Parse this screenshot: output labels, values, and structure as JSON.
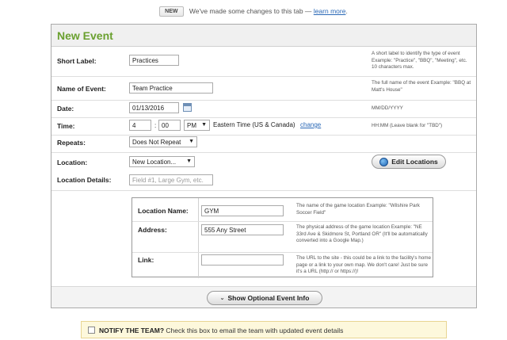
{
  "notice": {
    "badge": "NEW",
    "text": "We've made some changes to this tab —",
    "link": "learn more",
    "end": "."
  },
  "panel": {
    "title": "New Event"
  },
  "short_label": {
    "label": "Short Label:",
    "value": "Practices",
    "help": "A short label to identify the type of event Example: \"Practice\", \"BBQ\", \"Meeting\", etc. 10 characters max."
  },
  "name_of_event": {
    "label": "Name of Event:",
    "value": "Team Practice",
    "help": "The full name of the event Example: \"BBQ at Matt's House\""
  },
  "date": {
    "label": "Date:",
    "value": "01/13/2016",
    "help": "MM/DD/YYYY"
  },
  "time": {
    "label": "Time:",
    "hour": "4",
    "separator": ":",
    "minute": "00",
    "ampm": "PM",
    "timezone": "Eastern Time (US & Canada)",
    "change_link": "change",
    "help": "HH:MM (Leave blank for \"TBD\")"
  },
  "repeats": {
    "label": "Repeats:",
    "selected": "Does Not Repeat"
  },
  "location": {
    "label": "Location:",
    "selected": "New Location...",
    "edit_button": "Edit Locations"
  },
  "location_details": {
    "label": "Location Details:",
    "placeholder": "Field #1, Large Gym, etc."
  },
  "location_box": {
    "name": {
      "label": "Location Name:",
      "value": "GYM",
      "help": "The name of the game location Example: \"Wilshire Park Soccer Field\""
    },
    "address": {
      "label": "Address:",
      "value": "555 Any Street",
      "help": "The physical address of the game location Example: \"NE 33rd Ave & Skidmore St, Portland OR\" (It'll be automatically converted into a Google Map.)"
    },
    "link": {
      "label": "Link:",
      "value": "",
      "help": "The URL to the site - this could be a link to the facility's home page or a link to your own map. We don't care! Just be sure it's a URL (http:// or https://)!"
    }
  },
  "optional_button": "Show Optional Event Info",
  "notify": {
    "bold": "NOTIFY THE TEAM?",
    "text": "Check this box to email the team with updated event details",
    "checked": false
  },
  "colors": {
    "title_green": "#6aa02f",
    "link_blue": "#2a68b6",
    "notify_bg": "#fdf8dc"
  }
}
